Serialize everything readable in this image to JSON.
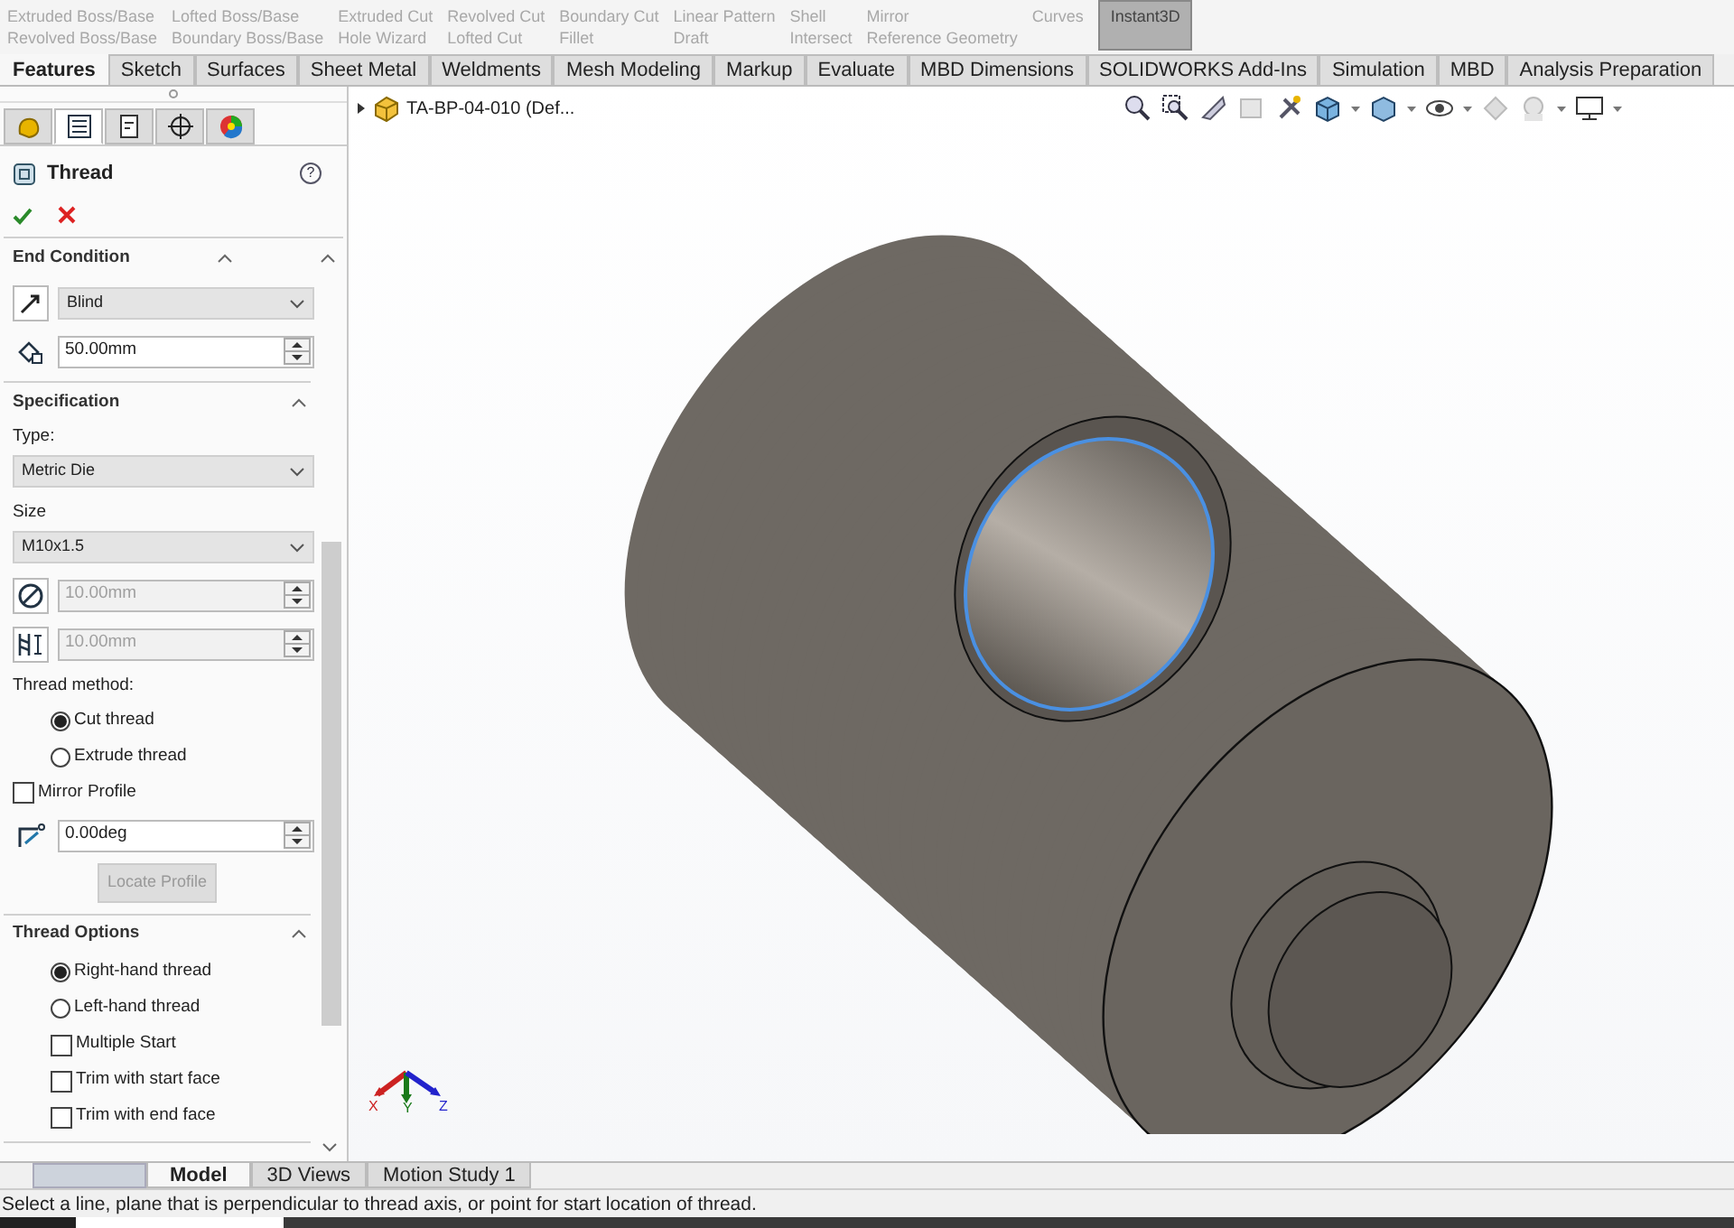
{
  "ribbon": {
    "items": [
      {
        "label": "Extruded Boss/Base",
        "disabled": true
      },
      {
        "label": "Revolved Boss/Base",
        "disabled": true
      },
      {
        "label": "Lofted Boss/Base",
        "disabled": true
      },
      {
        "label": "Boundary Boss/Base",
        "disabled": true
      },
      {
        "label": "Extruded Cut",
        "disabled": true
      },
      {
        "label": "Hole Wizard",
        "disabled": true
      },
      {
        "label": "Revolved Cut",
        "disabled": true
      },
      {
        "label": "Lofted Cut",
        "disabled": true
      },
      {
        "label": "Boundary Cut",
        "disabled": true
      },
      {
        "label": "Fillet",
        "disabled": true
      },
      {
        "label": "Linear Pattern",
        "disabled": true
      },
      {
        "label": "Draft",
        "disabled": true
      },
      {
        "label": "Shell",
        "disabled": true
      },
      {
        "label": "Intersect",
        "disabled": true
      },
      {
        "label": "Mirror",
        "disabled": true
      },
      {
        "label": "Reference Geometry",
        "disabled": true
      },
      {
        "label": "Curves",
        "disabled": true
      }
    ],
    "instant3d": {
      "label": "Instant3D",
      "selected": true
    }
  },
  "command_tabs": [
    {
      "label": "Features",
      "selected": true
    },
    {
      "label": "Sketch",
      "selected": false
    },
    {
      "label": "Surfaces",
      "selected": false
    },
    {
      "label": "Sheet Metal",
      "selected": false
    },
    {
      "label": "Weldments",
      "selected": false
    },
    {
      "label": "Mesh Modeling",
      "selected": false
    },
    {
      "label": "Markup",
      "selected": false
    },
    {
      "label": "Evaluate",
      "selected": false
    },
    {
      "label": "MBD Dimensions",
      "selected": false
    },
    {
      "label": "SOLIDWORKS Add-Ins",
      "selected": false
    },
    {
      "label": "Simulation",
      "selected": false
    },
    {
      "label": "MBD",
      "selected": false
    },
    {
      "label": "Analysis Preparation",
      "selected": false
    }
  ],
  "panel_tabs": [
    {
      "kind": "feature",
      "selected": false
    },
    {
      "kind": "property",
      "selected": true
    },
    {
      "kind": "configuration",
      "selected": false
    },
    {
      "kind": "dimxpert",
      "selected": false
    },
    {
      "kind": "display",
      "selected": false
    }
  ],
  "property_manager": {
    "title": "Thread",
    "help": "?",
    "end_condition": {
      "title": "End Condition",
      "condition": "Blind",
      "length": "50.00mm"
    },
    "specification": {
      "title": "Specification",
      "type_label": "Type:",
      "type": "Metric Die",
      "size_label": "Size",
      "size": "M10x1.5",
      "diameter": {
        "value": "10.00mm",
        "disabled": true
      },
      "pitch": {
        "value": "10.00mm",
        "disabled": true
      },
      "method_label": "Thread method:",
      "methods": [
        {
          "label": "Cut thread",
          "selected": true
        },
        {
          "label": "Extrude thread",
          "selected": false
        }
      ],
      "mirror_profile": {
        "label": "Mirror Profile",
        "checked": false
      },
      "angle": "0.00deg",
      "locate_button": {
        "label": "Locate Profile",
        "disabled": true
      }
    },
    "thread_options": {
      "title": "Thread Options",
      "hands": [
        {
          "label": "Right-hand thread",
          "selected": true
        },
        {
          "label": "Left-hand thread",
          "selected": false
        }
      ],
      "options": [
        {
          "label": "Multiple Start",
          "checked": false
        },
        {
          "label": "Trim with start face",
          "checked": false
        },
        {
          "label": "Trim with end face",
          "checked": false
        }
      ]
    }
  },
  "viewport": {
    "tree_item": "TA-BP-04-010  (Def...",
    "triad": [
      "X",
      "Y",
      "Z"
    ]
  },
  "bottom_tabs": [
    {
      "label": "Model",
      "selected": true
    },
    {
      "label": "3D Views",
      "selected": false
    },
    {
      "label": "Motion Study 1",
      "selected": false
    }
  ],
  "status_bar": "Select a line, plane that is perpendicular to thread axis, or point for start location of thread."
}
